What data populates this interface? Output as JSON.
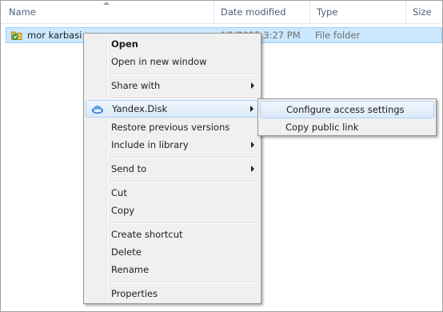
{
  "columns": {
    "name": "Name",
    "date_modified": "Date modified",
    "type": "Type",
    "size": "Size"
  },
  "file_row": {
    "name": "mor karbasi",
    "date": "4/1/2015 3:27 PM",
    "type": "File folder"
  },
  "context_menu": {
    "open": "Open",
    "open_new_window": "Open in new window",
    "share_with": "Share with",
    "yandex_disk": "Yandex.Disk",
    "restore_previous": "Restore previous versions",
    "include_in_library": "Include in library",
    "send_to": "Send to",
    "cut": "Cut",
    "copy": "Copy",
    "create_shortcut": "Create shortcut",
    "delete": "Delete",
    "rename": "Rename",
    "properties": "Properties"
  },
  "submenu": {
    "configure_access": "Configure access settings",
    "copy_public_link": "Copy public link"
  },
  "colors": {
    "selection": "#cce8ff",
    "hover": "#dbe9f9",
    "menu_bg": "#f0f0f0",
    "header_text": "#4c607a"
  }
}
